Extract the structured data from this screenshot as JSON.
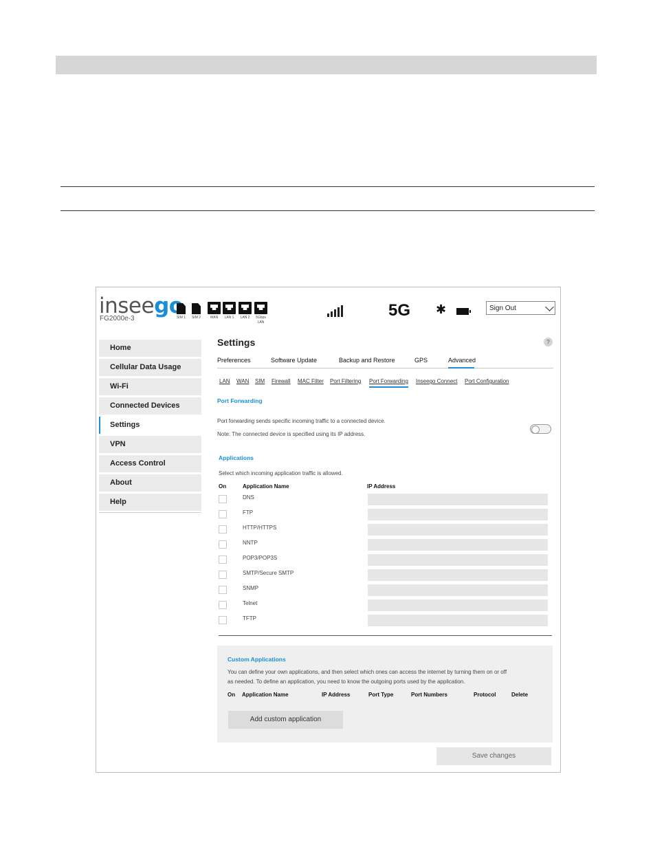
{
  "header": {
    "logo_prefix": "insee",
    "logo_suffix": "go",
    "model": "FG2000e-3",
    "sims": [
      "SIM 1",
      "SIM 2"
    ],
    "ports": [
      "WAN",
      "LAN 1",
      "LAN 2",
      "5Gbps LAN"
    ],
    "network": "5G",
    "signin_select": "Sign Out",
    "icons": [
      "signal-icon",
      "bluetooth-icon",
      "battery-icon"
    ]
  },
  "sidebar": {
    "items": [
      {
        "label": "Home"
      },
      {
        "label": "Cellular Data Usage"
      },
      {
        "label": "Wi-Fi"
      },
      {
        "label": "Connected Devices"
      },
      {
        "label": "Settings"
      },
      {
        "label": "VPN"
      },
      {
        "label": "Access Control"
      },
      {
        "label": "About"
      },
      {
        "label": "Help"
      }
    ],
    "active": "Settings"
  },
  "main": {
    "title": "Settings",
    "help": "?",
    "tabs": [
      {
        "label": "Preferences"
      },
      {
        "label": "Software Update"
      },
      {
        "label": "Backup and Restore"
      },
      {
        "label": "GPS"
      },
      {
        "label": "Advanced"
      }
    ],
    "active_tab": "Advanced",
    "subtabs": [
      {
        "label": "LAN"
      },
      {
        "label": "WAN"
      },
      {
        "label": "SIM"
      },
      {
        "label": "Firewall"
      },
      {
        "label": "MAC Filter"
      },
      {
        "label": "Port Filtering"
      },
      {
        "label": "Port Forwarding"
      },
      {
        "label": "Inseego Connect"
      },
      {
        "label": "Port Configuration"
      }
    ],
    "active_subtab": "Port Forwarding",
    "port_forwarding": {
      "heading": "Port Forwarding",
      "desc": "Port forwarding sends specific incoming traffic to a connected device.",
      "note": "Note: The connected device is specified using its IP address.",
      "enabled": false
    },
    "applications": {
      "heading": "Applications",
      "desc": "Select which incoming application traffic is allowed.",
      "columns": [
        "On",
        "Application Name",
        "IP Address"
      ],
      "rows": [
        {
          "name": "DNS"
        },
        {
          "name": "FTP"
        },
        {
          "name": "HTTP/HTTPS"
        },
        {
          "name": "NNTP"
        },
        {
          "name": "POP3/POP3S"
        },
        {
          "name": "SMTP/Secure SMTP"
        },
        {
          "name": "SNMP"
        },
        {
          "name": "Telnet"
        },
        {
          "name": "TFTP"
        }
      ]
    },
    "custom": {
      "heading": "Custom Applications",
      "desc_line1": "You can define your own applications, and then select which ones can access the internet by turning them on or off",
      "desc_line2": "as needed. To define an application, you need to know the outgoing ports used by the application.",
      "columns": [
        "On",
        "Application Name",
        "IP Address",
        "Port Type",
        "Port Numbers",
        "Protocol",
        "Delete"
      ],
      "add_label": "Add custom application"
    },
    "save_label": "Save changes"
  },
  "colors": {
    "accent": "#1a8fd6",
    "sidebar_bg": "#ebebeb",
    "field_bg": "#e6e6e6"
  }
}
